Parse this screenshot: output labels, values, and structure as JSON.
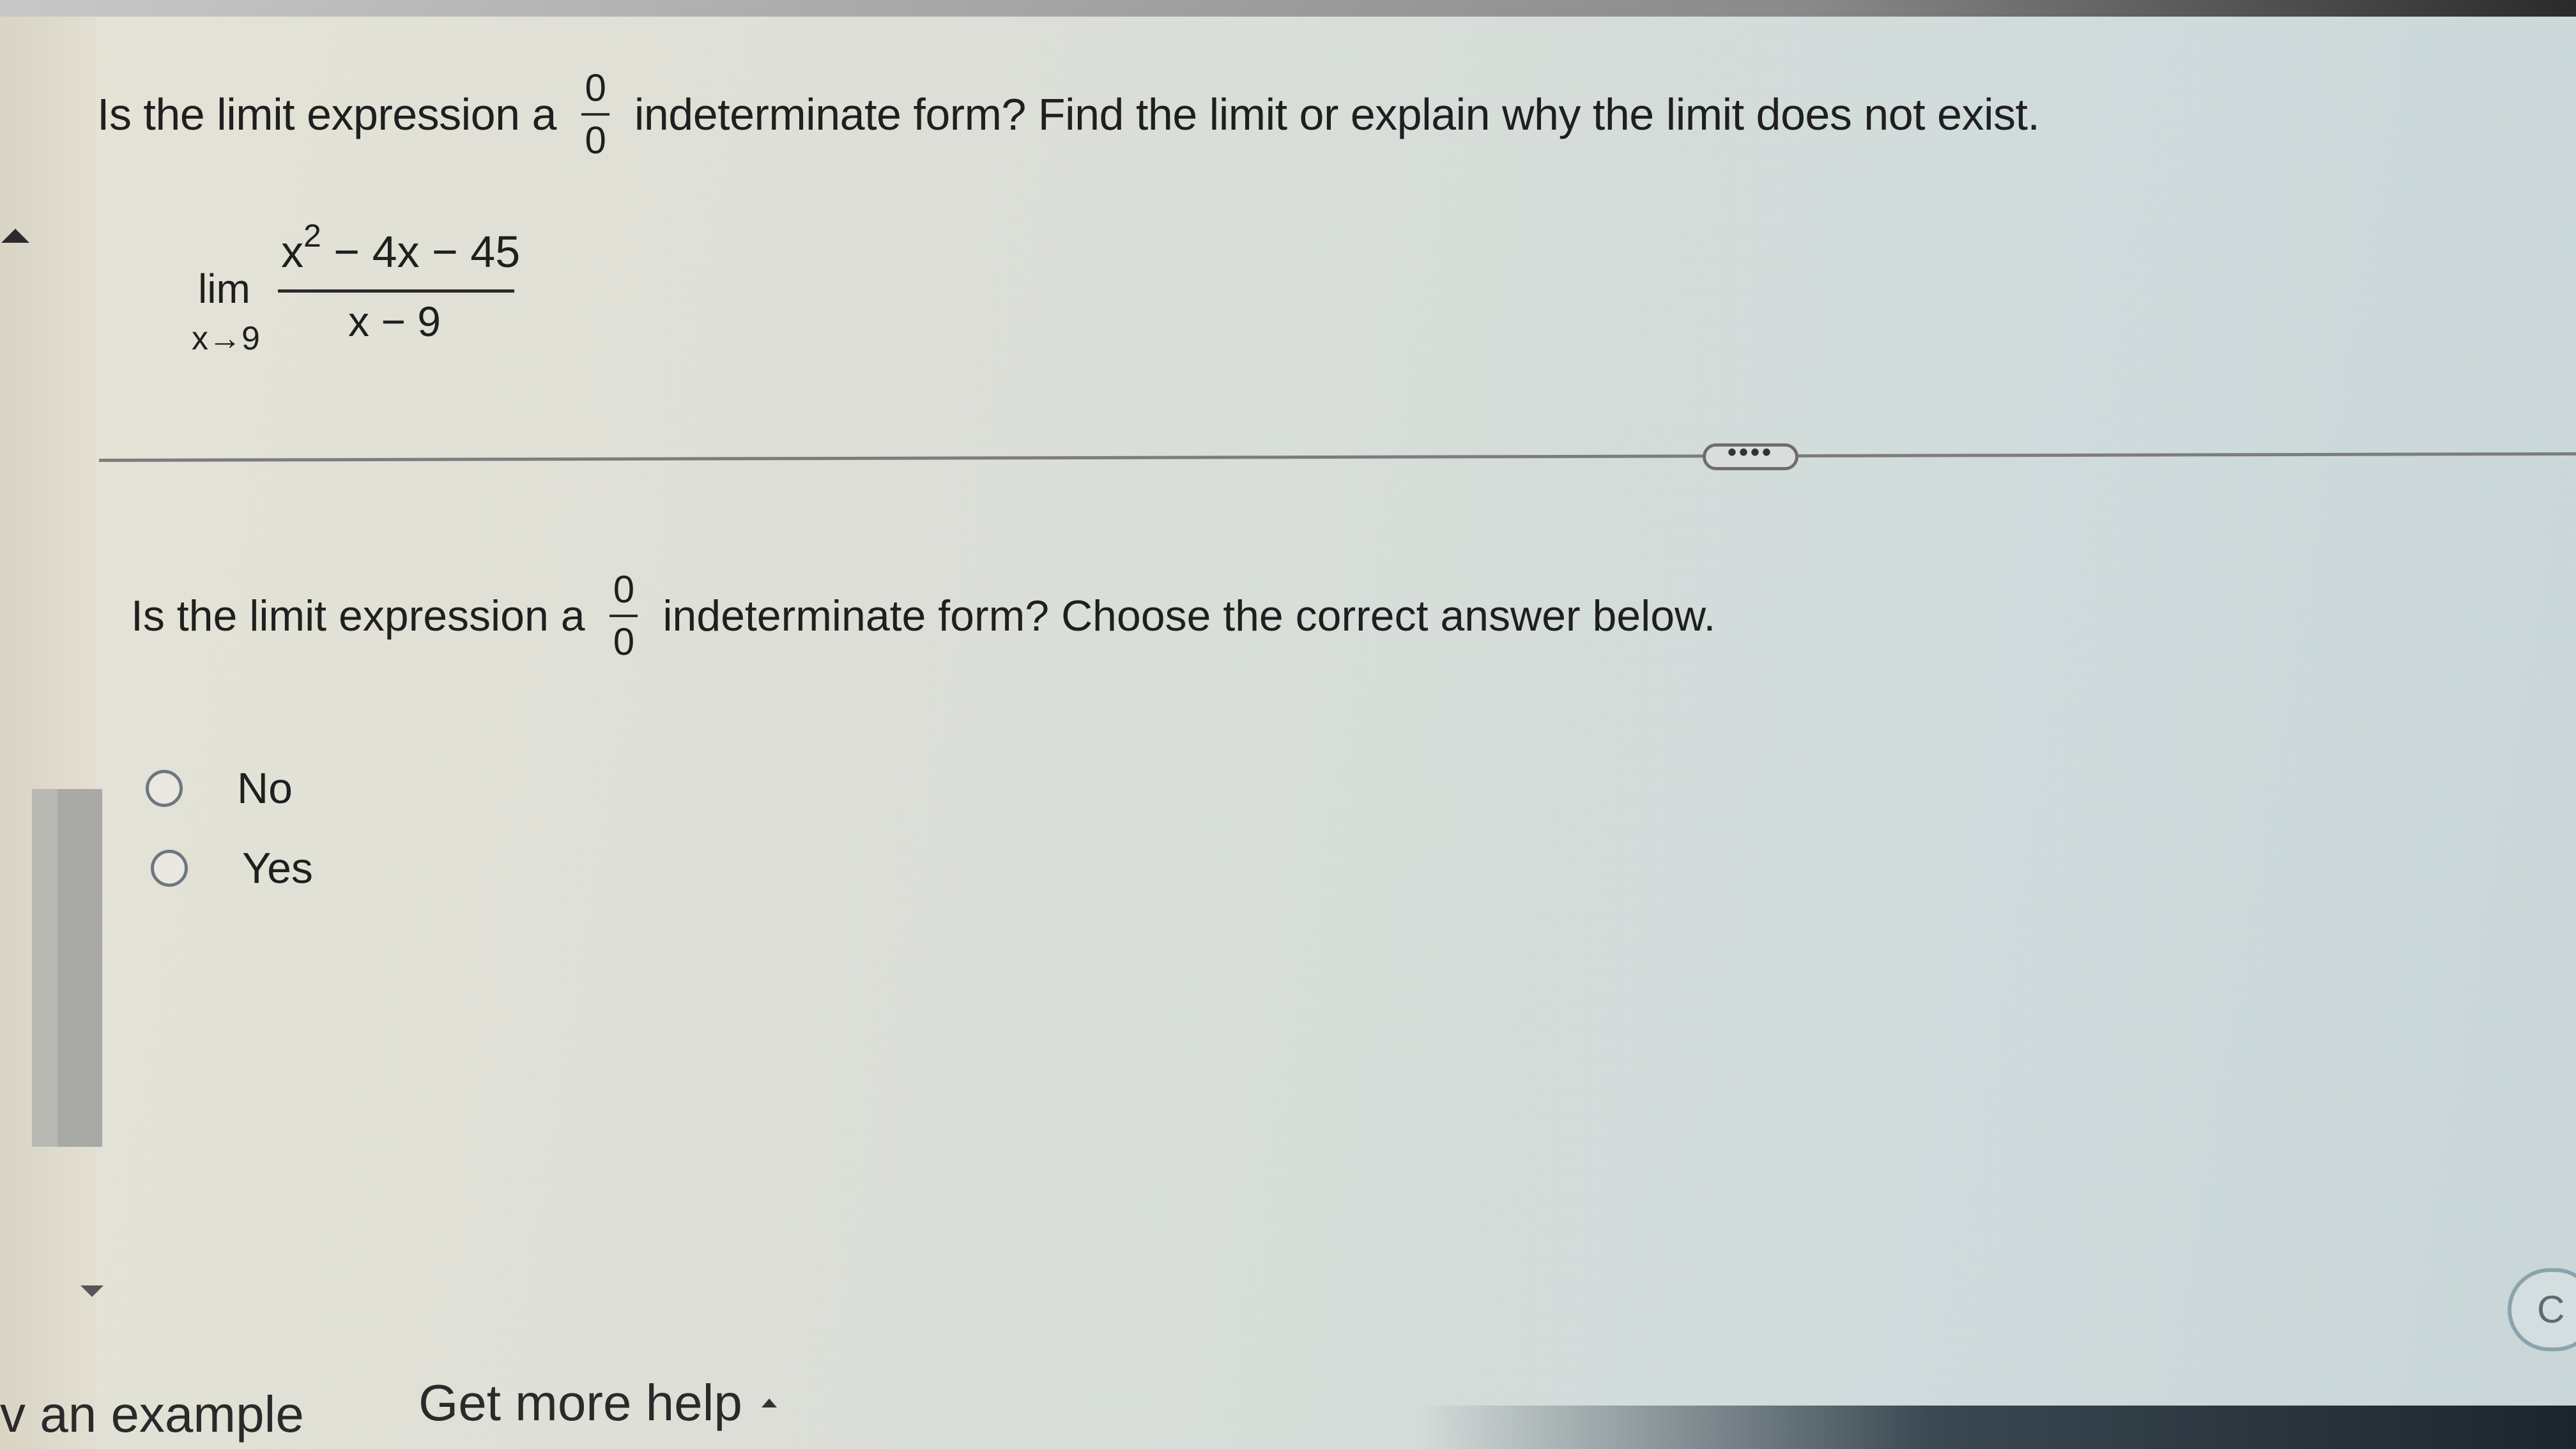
{
  "question": {
    "prompt_before": "Is the limit expression a",
    "fraction": {
      "numerator": "0",
      "denominator": "0"
    },
    "prompt_after": "indeterminate form? Find the limit or explain why the limit does not exist."
  },
  "limit": {
    "lim_word": "lim",
    "approach": "x→9",
    "numerator_base": "x",
    "numerator_exp": "2",
    "numerator_rest": " − 4x − 45",
    "denominator": "x − 9"
  },
  "more_button": {
    "label": "••••"
  },
  "part": {
    "prompt_before": "Is the limit expression a",
    "fraction": {
      "numerator": "0",
      "denominator": "0"
    },
    "prompt_after": "indeterminate form? Choose the correct answer below."
  },
  "options": [
    {
      "label": "No",
      "selected": false
    },
    {
      "label": "Yes",
      "selected": false
    }
  ],
  "footer": {
    "example_label": "v an example",
    "help_label": "Get more help",
    "check_label": "C"
  }
}
